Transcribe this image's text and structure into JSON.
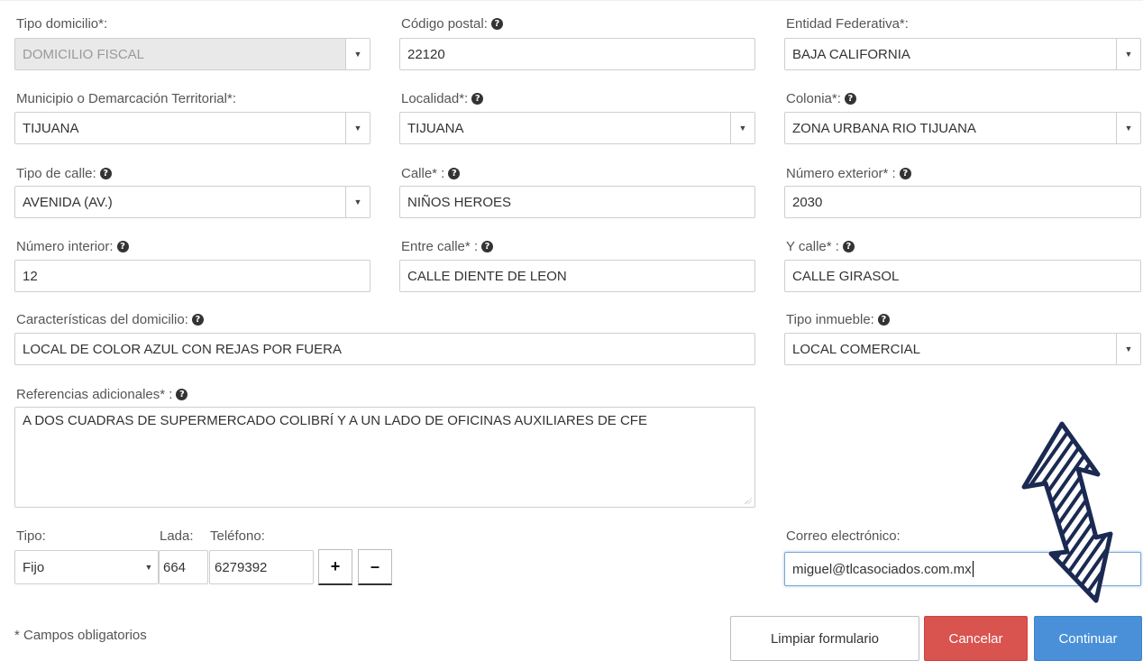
{
  "form": {
    "tipo_domicilio": {
      "label": "Tipo domicilio*:",
      "value": "DOMICILIO FISCAL"
    },
    "codigo_postal": {
      "label": "Código postal:",
      "value": "22120"
    },
    "entidad_federativa": {
      "label": "Entidad Federativa*:",
      "value": "BAJA CALIFORNIA"
    },
    "municipio": {
      "label": "Municipio o Demarcación Territorial*:",
      "value": "TIJUANA"
    },
    "localidad": {
      "label": "Localidad*:",
      "value": "TIJUANA"
    },
    "colonia": {
      "label": "Colonia*:",
      "value": "ZONA URBANA RIO TIJUANA"
    },
    "tipo_calle": {
      "label": "Tipo de calle:",
      "value": "AVENIDA (AV.)"
    },
    "calle": {
      "label": "Calle* :",
      "value": "NIÑOS HEROES"
    },
    "numero_exterior": {
      "label": "Número exterior* :",
      "value": "2030"
    },
    "numero_interior": {
      "label": "Número interior:",
      "value": "12"
    },
    "entre_calle": {
      "label": "Entre calle* :",
      "value": "CALLE DIENTE DE LEON"
    },
    "y_calle": {
      "label": "Y calle* :",
      "value": "CALLE GIRASOL"
    },
    "caracteristicas": {
      "label": "Características del domicilio:",
      "value": "LOCAL DE COLOR AZUL CON REJAS POR FUERA"
    },
    "tipo_inmueble": {
      "label": "Tipo inmueble:",
      "value": "LOCAL COMERCIAL"
    },
    "referencias": {
      "label": "Referencias adicionales* :",
      "value": "A DOS CUADRAS DE SUPERMERCADO COLIBRÍ Y A UN LADO DE OFICINAS AUXILIARES DE CFE"
    },
    "telefono": {
      "tipo_label": "Tipo:",
      "tipo_value": "Fijo",
      "lada_label": "Lada:",
      "lada_value": "664",
      "telefono_label": "Teléfono:",
      "telefono_value": "6279392",
      "add_label": "+",
      "remove_label": "–"
    },
    "correo": {
      "label": "Correo electrónico:",
      "value": "miguel@tlcasociados.com.mx"
    }
  },
  "footnote": "* Campos obligatorios",
  "buttons": {
    "clear": "Limpiar formulario",
    "cancel": "Cancelar",
    "continue": "Continuar"
  },
  "colors": {
    "cancel": "#d9534f",
    "continue": "#4a90d9",
    "annotation_arrow": "#1b2a52"
  },
  "icons": {
    "help": "question-circle-icon",
    "dropdown": "caret-down-icon",
    "annotation": "double-arrow-icon"
  }
}
